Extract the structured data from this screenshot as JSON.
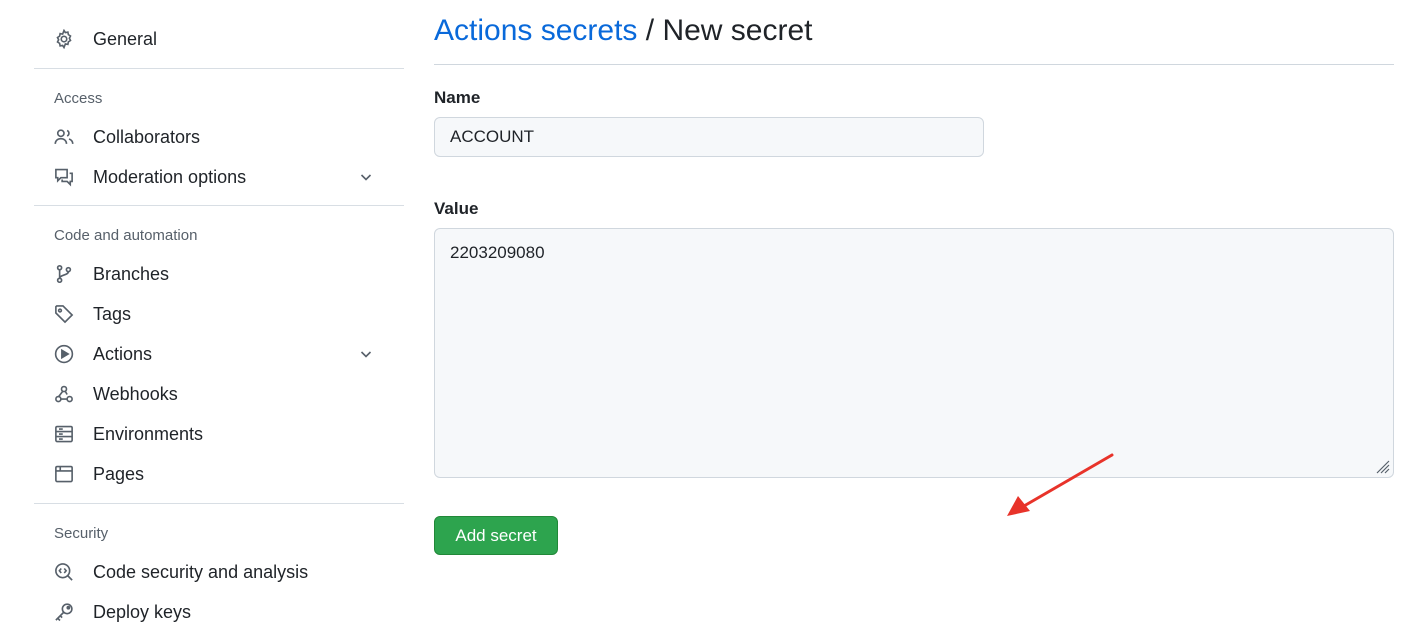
{
  "sidebar": {
    "general": {
      "label": "General",
      "icon": "gear-icon"
    },
    "sections": {
      "access": "Access",
      "code_automation": "Code and automation",
      "security": "Security"
    },
    "access_items": [
      {
        "label": "Collaborators",
        "icon": "people-icon"
      },
      {
        "label": "Moderation options",
        "icon": "comment-discussion-icon",
        "expandable": true
      }
    ],
    "code_items": [
      {
        "label": "Branches",
        "icon": "git-branch-icon"
      },
      {
        "label": "Tags",
        "icon": "tag-icon"
      },
      {
        "label": "Actions",
        "icon": "play-icon",
        "expandable": true
      },
      {
        "label": "Webhooks",
        "icon": "webhook-icon"
      },
      {
        "label": "Environments",
        "icon": "server-icon"
      },
      {
        "label": "Pages",
        "icon": "browser-icon"
      }
    ],
    "security_items": [
      {
        "label": "Code security and analysis",
        "icon": "codescan-icon"
      },
      {
        "label": "Deploy keys",
        "icon": "key-icon"
      }
    ]
  },
  "main": {
    "breadcrumb_link": "Actions secrets",
    "breadcrumb_separator": " / ",
    "breadcrumb_current": "New secret",
    "name_label": "Name",
    "name_value": "ACCOUNT",
    "value_label": "Value",
    "value_value": "2203209080",
    "add_button_label": "Add secret"
  },
  "colors": {
    "link": "#0969da",
    "button_green": "#2da44e",
    "annotation_arrow": "#e8332a"
  }
}
